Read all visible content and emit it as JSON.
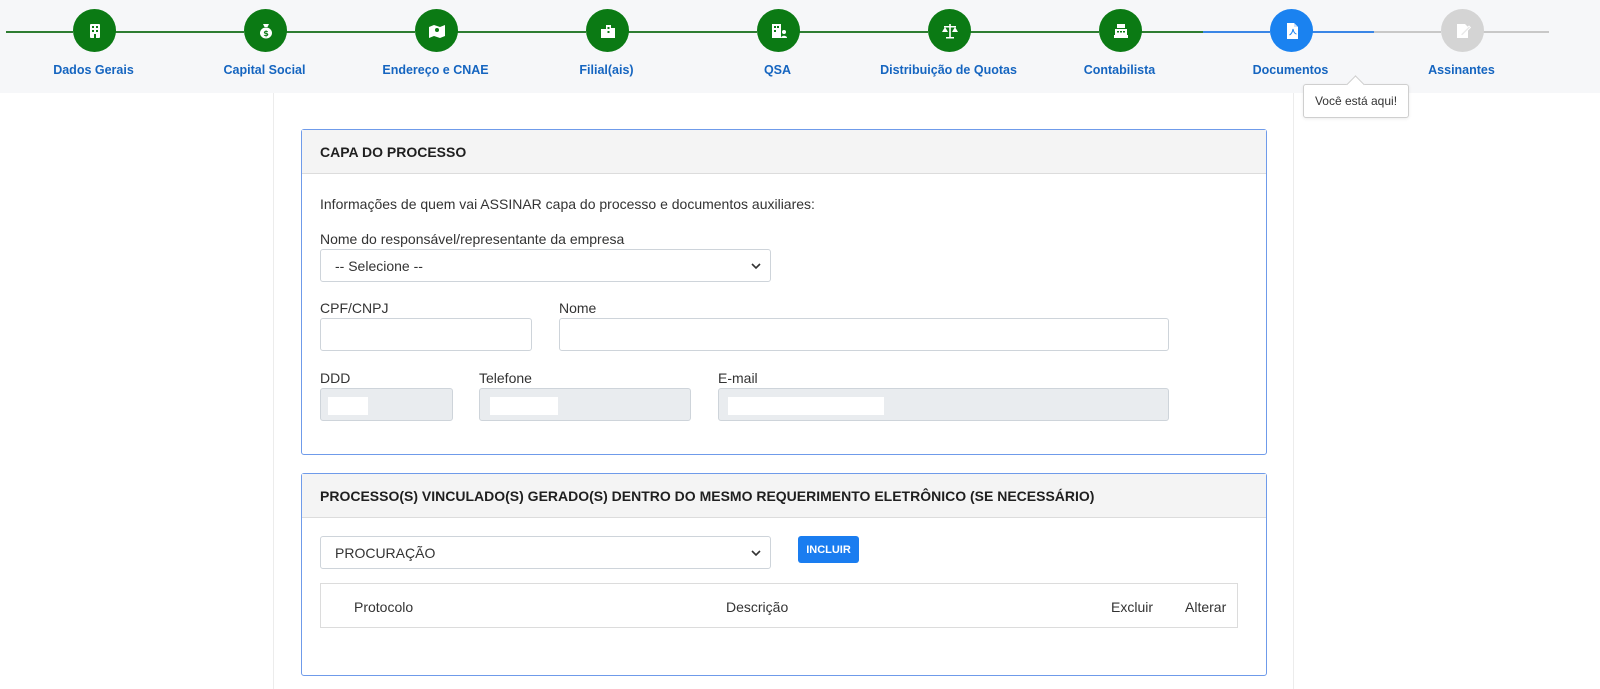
{
  "stepper": {
    "steps": [
      {
        "label": "Dados Gerais",
        "status": "done",
        "icon": "building-icon"
      },
      {
        "label": "Capital Social",
        "status": "done",
        "icon": "money-bag-icon"
      },
      {
        "label": "Endereço e CNAE",
        "status": "done",
        "icon": "map-icon"
      },
      {
        "label": "Filial(ais)",
        "status": "done",
        "icon": "city-icon"
      },
      {
        "label": "QSA",
        "status": "done",
        "icon": "building-user-icon"
      },
      {
        "label": "Distribuição de Quotas",
        "status": "done",
        "icon": "scale-icon"
      },
      {
        "label": "Contabilista",
        "status": "done",
        "icon": "cash-register-icon"
      },
      {
        "label": "Documentos",
        "status": "current",
        "icon": "pdf-file-icon"
      },
      {
        "label": "Assinantes",
        "status": "todo",
        "icon": "signature-icon"
      }
    ],
    "tooltip": "Você está aqui!"
  },
  "capa": {
    "title": "CAPA DO PROCESSO",
    "intro": "Informações de quem vai ASSINAR capa do processo e documentos auxiliares:",
    "responsavel_label": "Nome do responsável/representante da empresa",
    "responsavel_value": "-- Selecione --",
    "cpf_label": "CPF/CNPJ",
    "nome_label": "Nome",
    "ddd_label": "DDD",
    "telefone_label": "Telefone",
    "email_label": "E-mail"
  },
  "vinculados": {
    "title": "PROCESSO(S) VINCULADO(S) GERADO(S) DENTRO DO MESMO REQUERIMENTO ELETRÔNICO (SE NECESSÁRIO)",
    "select_value": "PROCURAÇÃO",
    "incluir_label": "INCLUIR",
    "columns": [
      "Protocolo",
      "Descrição",
      "Excluir",
      "Alterar"
    ]
  },
  "colors": {
    "done": "#0b7a14",
    "current": "#1a82f0",
    "todo": "#d4d4d4",
    "label": "#1565c0",
    "card_border": "#6f9bea",
    "button": "#1a7df0"
  }
}
